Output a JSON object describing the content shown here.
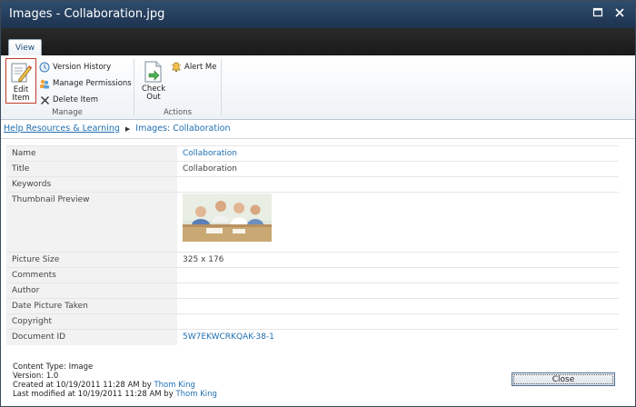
{
  "window": {
    "title": "Images - Collaboration.jpg"
  },
  "tabs": [
    {
      "label": "View"
    }
  ],
  "ribbon": {
    "manage": {
      "label": "Manage",
      "edit_item": "Edit Item",
      "version_history": "Version History",
      "manage_permissions": "Manage Permissions",
      "delete_item": "Delete Item"
    },
    "actions": {
      "label": "Actions",
      "check_out": "Check Out",
      "alert_me": "Alert Me"
    }
  },
  "breadcrumb": {
    "root": "Help Resources & Learning",
    "current": "Images: Collaboration"
  },
  "properties": [
    {
      "key": "Name",
      "value": "Collaboration"
    },
    {
      "key": "Title",
      "value": "Collaboration"
    },
    {
      "key": "Keywords",
      "value": ""
    },
    {
      "key": "Thumbnail Preview",
      "value": ""
    },
    {
      "key": "Picture Size",
      "value": "325 x 176"
    },
    {
      "key": "Comments",
      "value": ""
    },
    {
      "key": "Author",
      "value": ""
    },
    {
      "key": "Date Picture Taken",
      "value": ""
    },
    {
      "key": "Copyright",
      "value": ""
    },
    {
      "key": "Document ID",
      "value": "5W7EKWCRKQAK-38-1"
    }
  ],
  "footer": {
    "content_type": "Content Type: Image",
    "version": "Version: 1.0",
    "created_prefix": "Created at 10/19/2011 11:28 AM by ",
    "created_by": "Thom King",
    "modified_prefix": "Last modified at 10/19/2011 11:28 AM by ",
    "modified_by": "Thom King"
  },
  "buttons": {
    "close": "Close"
  },
  "colors": {
    "titlebar": "#2f4d6d",
    "link": "#1f6fb2",
    "accent_edit": "#c0392b"
  }
}
